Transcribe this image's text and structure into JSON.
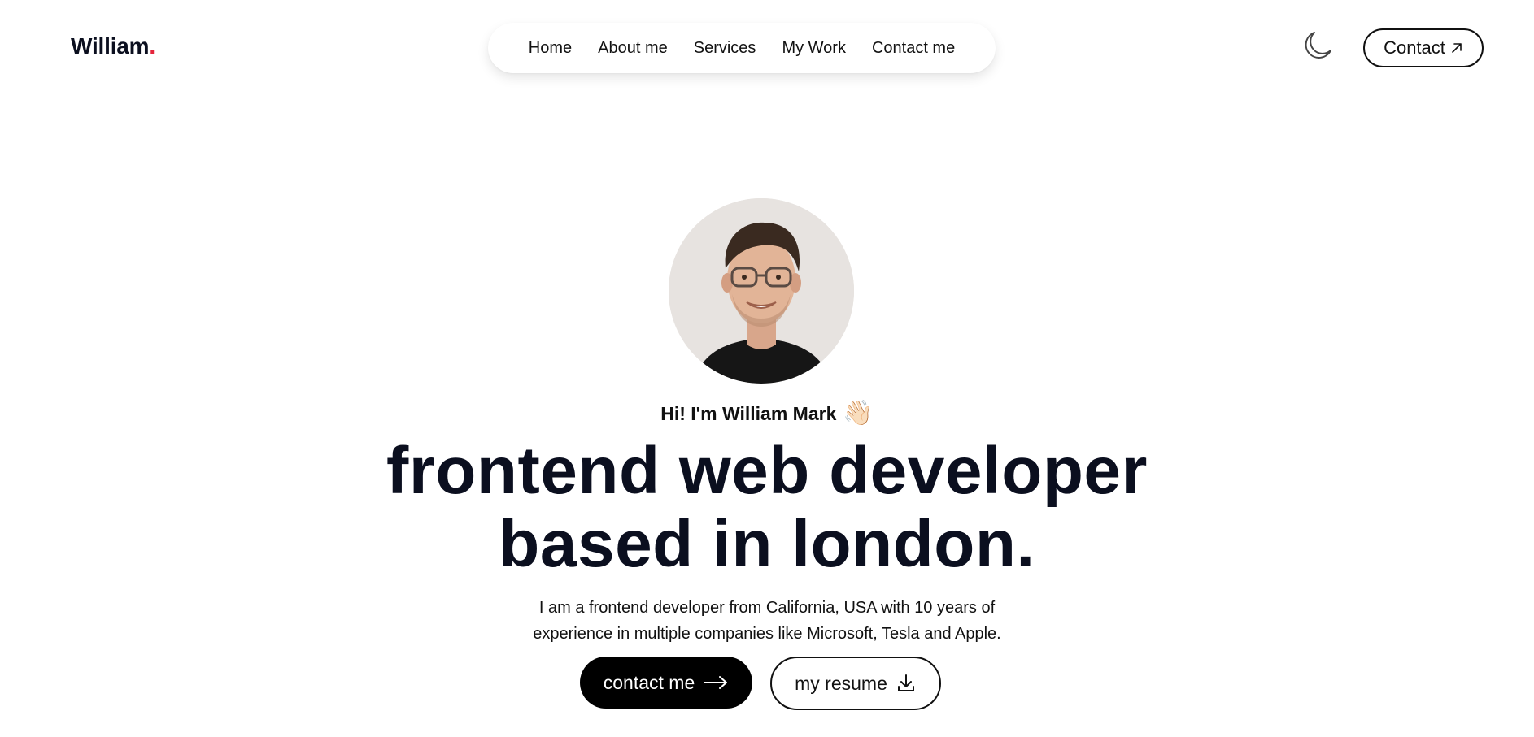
{
  "header": {
    "logo_text": "William",
    "logo_dot": ".",
    "nav_items": [
      {
        "label": "Home"
      },
      {
        "label": "About me"
      },
      {
        "label": "Services"
      },
      {
        "label": "My Work"
      },
      {
        "label": "Contact me"
      }
    ],
    "theme_toggle_icon": "moon-icon",
    "contact_button_label": "Contact",
    "contact_button_icon": "arrow-up-right-icon"
  },
  "hero": {
    "greeting": "Hi! I'm William Mark",
    "greeting_emoji": "👋🏻",
    "headline_line1": "frontend web developer",
    "headline_line2": "based in london.",
    "intro_line1": "I am a frontend developer from California, USA with 10 years of",
    "intro_line2": "experience in multiple companies like Microsoft, Tesla and Apple.",
    "primary_button_label": "contact me",
    "primary_button_icon": "arrow-right-icon",
    "secondary_button_label": "my resume",
    "secondary_button_icon": "download-icon"
  },
  "colors": {
    "accent_dot": "#e4243b",
    "text_dark": "#0b0f1f",
    "primary_button_bg": "#000000"
  }
}
